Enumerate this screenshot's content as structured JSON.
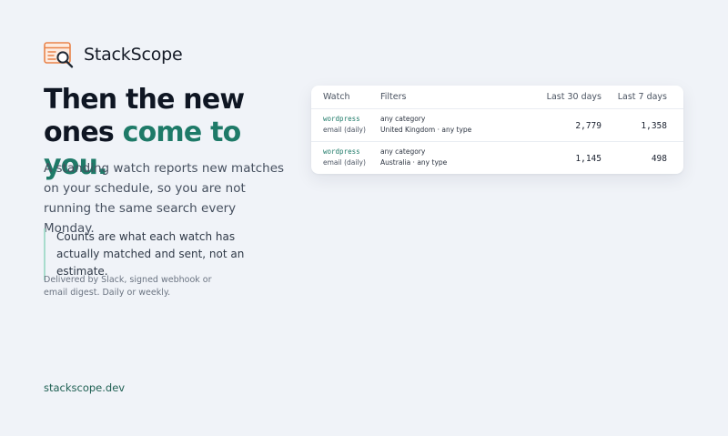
{
  "brand": {
    "name": "StackScope",
    "logo_icon": "code-window-magnifier-icon",
    "logo_colors": {
      "frame": "#e9834a",
      "lens": "#1d2733"
    }
  },
  "hero": {
    "headline_part1": "Then the new ones ",
    "headline_accent": "come to you.",
    "accent_color": "#1e7a68",
    "lede": "A standing watch reports new matches on your schedule, so you are not running the same search every Monday.",
    "callout": "Counts are what each watch has actually matched and sent, not an estimate.",
    "fineprint": "Delivered by Slack, signed webhook or email digest. Daily or weekly."
  },
  "table": {
    "headers": {
      "watch": "Watch",
      "filters": "Filters",
      "last30": "Last 30 days",
      "last7": "Last 7 days"
    },
    "rows": [
      {
        "term": "wordpress",
        "channel": "email (daily)",
        "filter_category": "any category",
        "filter_scope": "United Kingdom · any type",
        "last30": "2,779",
        "last7": "1,358"
      },
      {
        "term": "wordpress",
        "channel": "email (daily)",
        "filter_category": "any category",
        "filter_scope": "Australia · any type",
        "last30": "1,145",
        "last7": "498"
      }
    ]
  },
  "footer": {
    "link": "stackscope.dev"
  }
}
